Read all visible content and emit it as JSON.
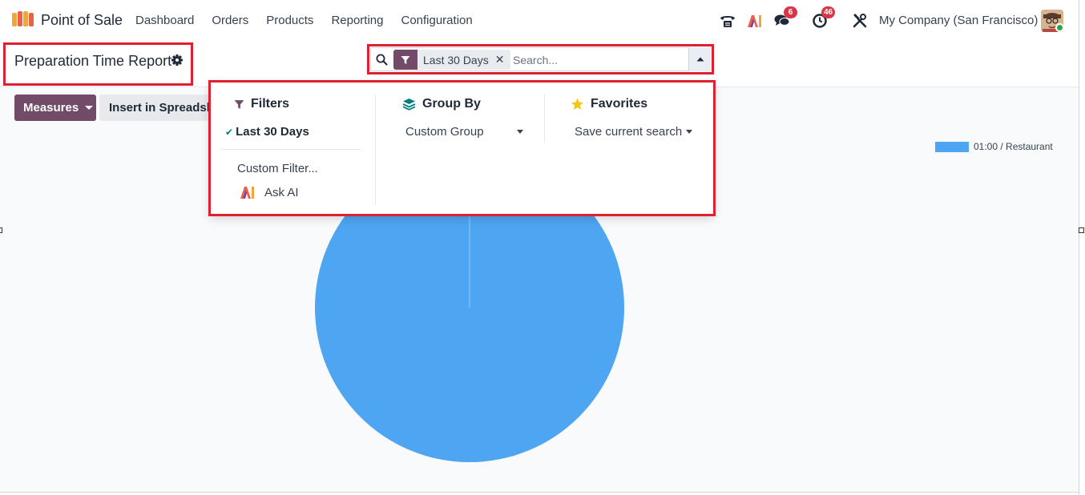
{
  "navbar": {
    "app_name": "Point of Sale",
    "menu": [
      "Dashboard",
      "Orders",
      "Products",
      "Reporting",
      "Configuration"
    ],
    "chat_badge": "6",
    "activity_badge": "46",
    "company": "My Company (San Francisco)"
  },
  "control_panel": {
    "page_title": "Preparation Time Report",
    "search": {
      "facet_label": "Last 30 Days",
      "facet_close": "✕",
      "placeholder": "Search..."
    }
  },
  "toolbar": {
    "measures_label": "Measures",
    "insert_label": "Insert in Spreadsheet"
  },
  "search_panel": {
    "filters": {
      "title": "Filters",
      "active_filter": "Last 30 Days",
      "custom_filter": "Custom Filter...",
      "ask_ai": "Ask AI"
    },
    "group_by": {
      "title": "Group By",
      "custom_group": "Custom Group"
    },
    "favorites": {
      "title": "Favorites",
      "save_search": "Save current search"
    }
  },
  "chart_data": {
    "type": "pie",
    "categories": [
      "01:00 / Restaurant"
    ],
    "values": [
      100
    ],
    "legend_position": "top-right",
    "colors": [
      "#4ea5f1"
    ]
  },
  "colors": {
    "brand": "#714b67",
    "highlight_outline": "#e02030",
    "pie": "#4ea5f1",
    "badge": "#dc3545"
  }
}
